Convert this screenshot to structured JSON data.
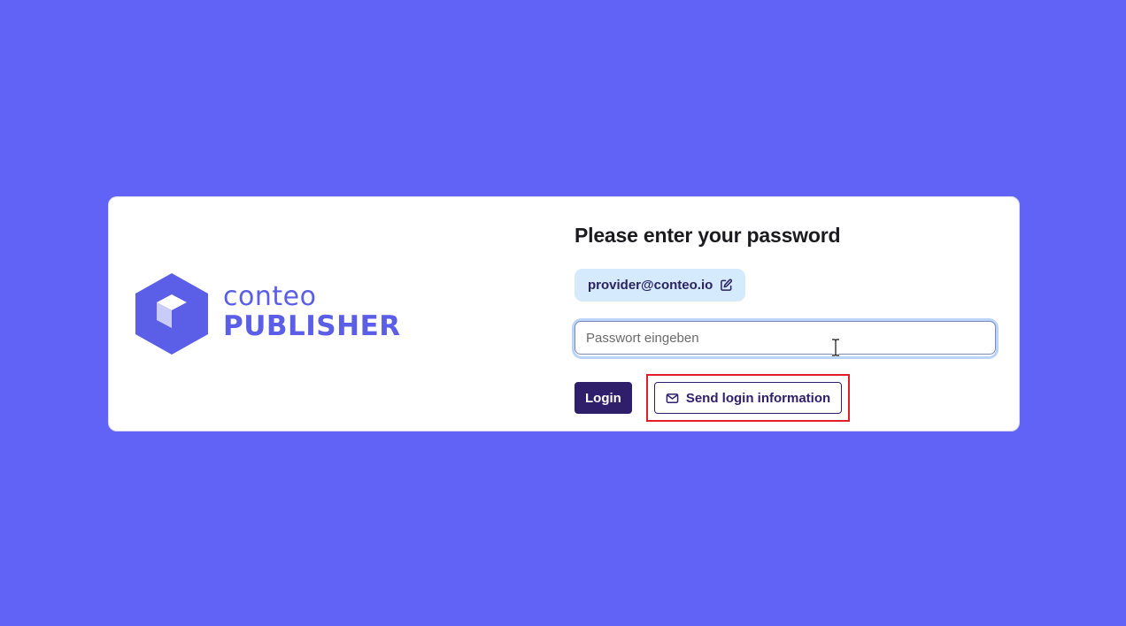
{
  "brand": {
    "name": "conteo",
    "product": "PUBLISHER",
    "logo_icon": "hexagon-cube-icon",
    "color": "#5b5ee6"
  },
  "form": {
    "title": "Please enter your password",
    "email": "provider@conteo.io",
    "email_edit_icon": "edit-icon",
    "password_placeholder": "Passwort eingeben",
    "password_value": "",
    "login_label": "Login",
    "send_label": "Send login information",
    "send_icon": "mail-icon"
  },
  "colors": {
    "background": "#6063f5",
    "primary_button": "#2f1f6b",
    "chip_background": "#d6eafe",
    "highlight": "#e11d2a"
  }
}
